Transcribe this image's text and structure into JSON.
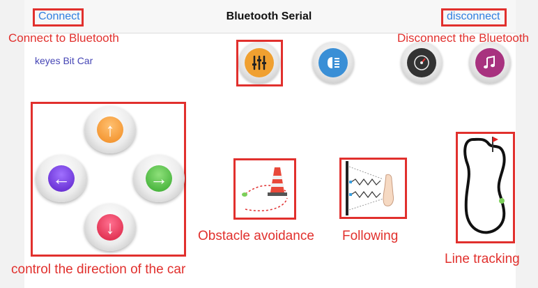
{
  "navbar": {
    "title": "Bluetooth Serial",
    "connect_label": "Connect",
    "disconnect_label": "disconnect"
  },
  "app_name": "keyes Bit Car",
  "annotations": {
    "connect": "Connect to Bluetooth",
    "disconnect": "Disconnect the Bluetooth",
    "direction": "control the direction of the car",
    "obstacle": "Obstacle avoidance",
    "following": "Following",
    "line_tracking": "Line tracking"
  },
  "top_icons": [
    {
      "name": "settings-sliders-icon",
      "color": "#f0a030"
    },
    {
      "name": "headlight-icon",
      "color": "#3a8fd6"
    },
    {
      "name": "speedometer-icon",
      "color": "#333333"
    },
    {
      "name": "music-icon",
      "color": "#a8327f"
    }
  ],
  "direction_buttons": {
    "up": {
      "icon": "arrow-up-icon",
      "color": "#f59a35"
    },
    "left": {
      "icon": "arrow-left-icon",
      "color": "#6c2fd9"
    },
    "right": {
      "icon": "arrow-right-icon",
      "color": "#45b43b"
    },
    "down": {
      "icon": "arrow-down-icon",
      "color": "#e22f4a"
    }
  },
  "colors": {
    "accent": "#2f7fe0",
    "annotation_red": "#e1302d"
  }
}
